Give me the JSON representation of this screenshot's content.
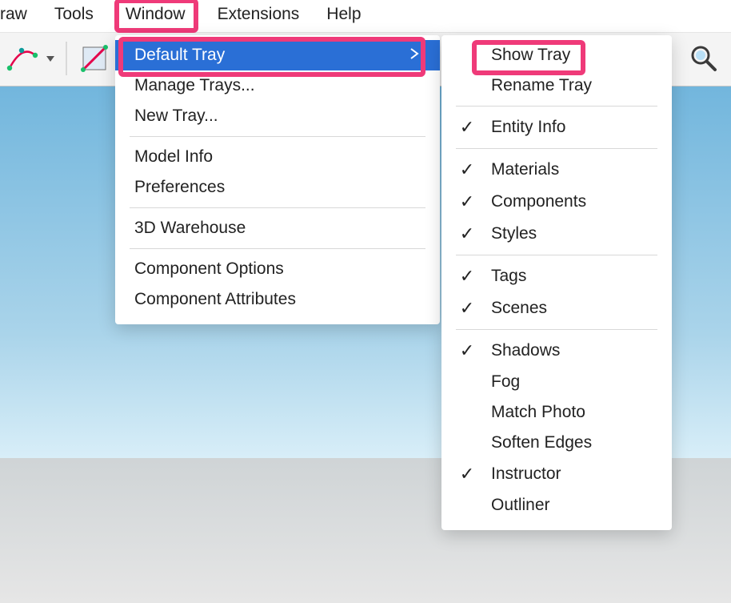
{
  "menubar": {
    "items": [
      "raw",
      "Tools",
      "Window",
      "Extensions",
      "Help"
    ]
  },
  "window_menu": {
    "default_tray": "Default Tray",
    "manage_trays": "Manage Trays...",
    "new_tray": "New Tray...",
    "model_info": "Model Info",
    "preferences": "Preferences",
    "warehouse": "3D Warehouse",
    "comp_options": "Component Options",
    "comp_attrs": "Component Attributes"
  },
  "submenu": {
    "show_tray": "Show Tray",
    "rename_tray": "Rename Tray",
    "entity_info": "Entity Info",
    "materials": "Materials",
    "components": "Components",
    "styles": "Styles",
    "tags": "Tags",
    "scenes": "Scenes",
    "shadows": "Shadows",
    "fog": "Fog",
    "match_photo": "Match Photo",
    "soften_edges": "Soften Edges",
    "instructor": "Instructor",
    "outliner": "Outliner"
  },
  "submenu_checked": {
    "entity_info": true,
    "materials": true,
    "components": true,
    "styles": true,
    "tags": true,
    "scenes": true,
    "shadows": true,
    "instructor": true
  },
  "icons": {
    "arc": "arc-tool",
    "edge": "edge-tool",
    "search": "search-icon"
  }
}
